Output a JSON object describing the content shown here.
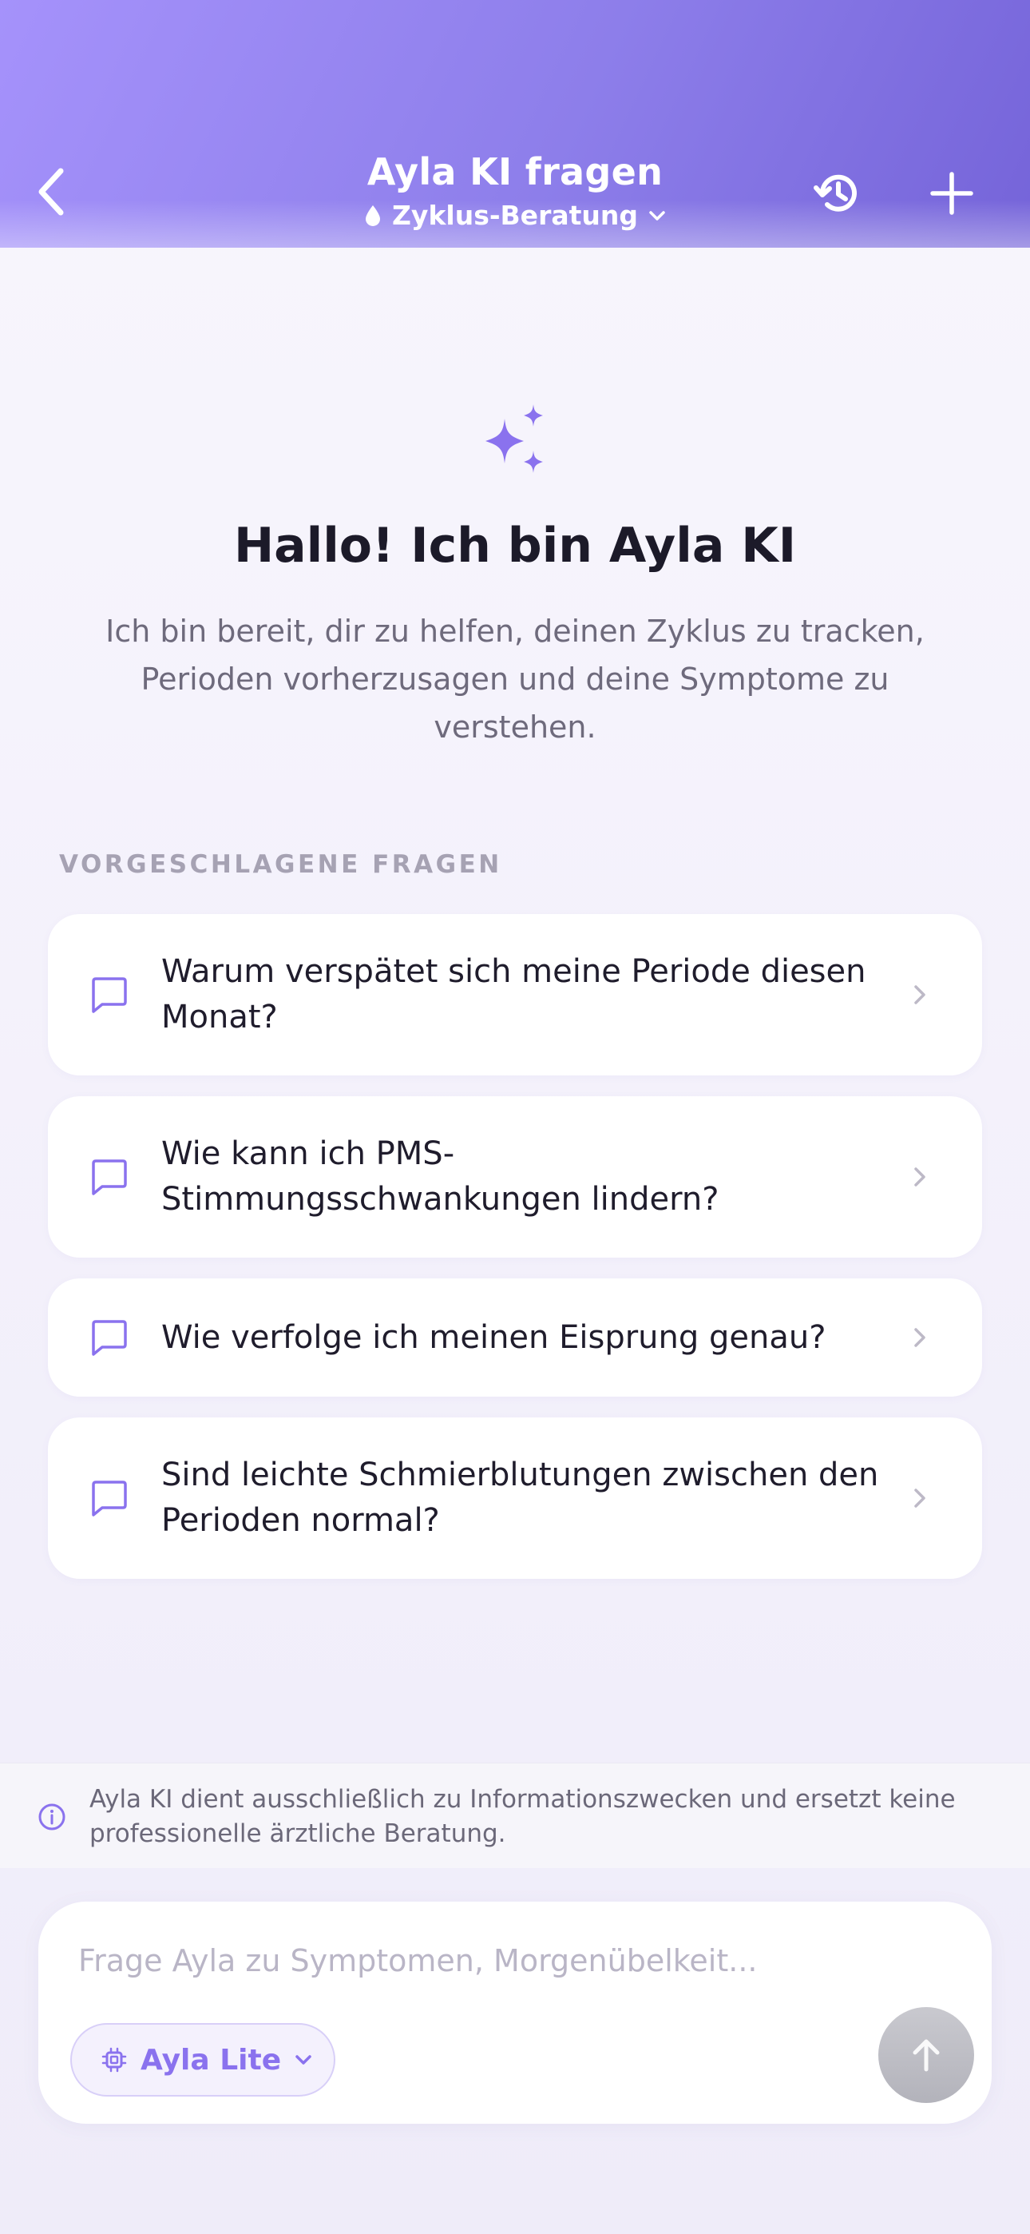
{
  "header": {
    "title": "Ayla KI fragen",
    "subtitle": "Zyklus-Beratung"
  },
  "hero": {
    "title": "Hallo! Ich bin Ayla KI",
    "text": "Ich bin bereit, dir zu helfen, deinen Zyklus zu tracken, Perioden vorherzusagen und deine Symptome zu verstehen."
  },
  "suggestions": {
    "label": "VORGESCHLAGENE FRAGEN",
    "items": [
      {
        "text": "Warum verspätet sich meine Periode diesen Monat?"
      },
      {
        "text": "Wie kann ich PMS-Stimmungsschwankungen lindern?"
      },
      {
        "text": "Wie verfolge ich meinen Eisprung genau?"
      },
      {
        "text": "Sind leichte Schmierblutungen zwischen den Perioden normal?"
      }
    ]
  },
  "disclaimer": {
    "text": "Ayla KI dient ausschließlich zu Informationszwecken und ersetzt keine professionelle ärztliche Beratung."
  },
  "composer": {
    "placeholder": "Frage Ayla zu Symptomen, Morgenübelkeit...",
    "value": "",
    "model_label": "Ayla Lite"
  },
  "colors": {
    "accent": "#8a72ee",
    "header_start": "#a592fb",
    "header_end": "#7564d9",
    "send_disabled": "#bdbdc4"
  }
}
